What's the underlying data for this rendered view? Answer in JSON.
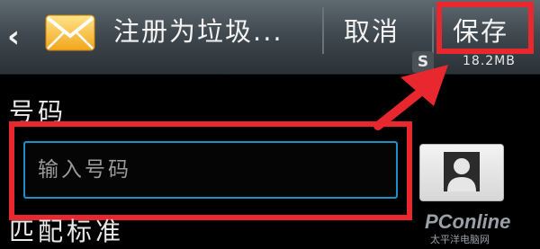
{
  "header": {
    "back_icon": "chevron-left-icon",
    "app_icon": "envelope-icon",
    "title": "注册为垃圾...",
    "cancel_label": "取消",
    "save_label": "保存"
  },
  "status": {
    "app_badge": "S",
    "memory": "18.2MB"
  },
  "form": {
    "number_label": "号码",
    "number_placeholder": "输入号码",
    "match_label": "匹配标准",
    "contact_button_icon": "contact-person-icon"
  },
  "watermark": {
    "brand": "PConline",
    "tagline": "太平洋电脑网"
  },
  "colors": {
    "highlight": "#e8282e",
    "input_focus": "#1d8fc5",
    "watermark": "#9aa0a6"
  }
}
